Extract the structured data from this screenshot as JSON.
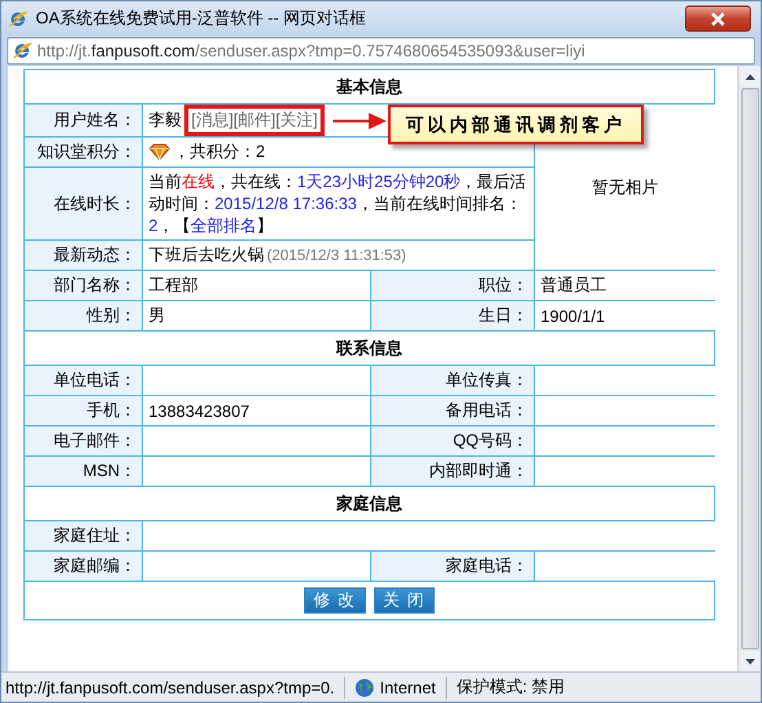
{
  "window": {
    "title": "OA系统在线免费试用-泛普软件 -- 网页对话框",
    "address": {
      "prefix": "http://jt.",
      "domain": "fanpusoft.com",
      "rest": "/senduser.aspx?tmp=0.7574680654535093&user=liyi"
    }
  },
  "sections": [
    {
      "title": "基本信息",
      "photo": "暂无相片",
      "rows": [
        {
          "kind": "name",
          "label": "用户姓名：",
          "value": "李毅",
          "links": [
            "[消息]",
            "[邮件]",
            "[关注]"
          ]
        },
        {
          "kind": "points",
          "label": "知识堂积分：",
          "value": "，共积分：2"
        },
        {
          "kind": "segments",
          "label": "在线时长：",
          "segments": [
            {
              "kind": "plain",
              "text": "当前"
            },
            {
              "kind": "red",
              "text": "在线"
            },
            {
              "kind": "plain",
              "text": "，共在线："
            },
            {
              "kind": "blue",
              "text": "1天23小时25分钟20秒"
            },
            {
              "kind": "plain",
              "text": "，最后活动时间："
            },
            {
              "kind": "blue",
              "text": "2015/12/8 17:36:33"
            },
            {
              "kind": "plain",
              "text": "，当前在线时间排名："
            },
            {
              "kind": "blue",
              "text": "2"
            },
            {
              "kind": "plain",
              "text": "，【"
            },
            {
              "kind": "link",
              "text": "全部排名"
            },
            {
              "kind": "plain",
              "text": "】"
            }
          ]
        },
        {
          "kind": "status",
          "label": "最新动态：",
          "value": "下班后去吃火锅",
          "time": "(2015/12/3 11:31:53)"
        },
        {
          "kind": "pair",
          "cells": [
            {
              "label": "部门名称：",
              "value": "工程部"
            },
            {
              "label": "职位：",
              "value": "普通员工"
            }
          ]
        },
        {
          "kind": "pair",
          "cells": [
            {
              "label": "性别：",
              "value": "男"
            },
            {
              "label": "生日：",
              "value": "1900/1/1"
            }
          ]
        }
      ]
    },
    {
      "title": "联系信息",
      "rows": [
        {
          "kind": "pair",
          "cells": [
            {
              "label": "单位电话："
            },
            {
              "label": "单位传真："
            }
          ]
        },
        {
          "kind": "pair",
          "cells": [
            {
              "label": "手机：",
              "value": "13883423807"
            },
            {
              "label": "备用电话："
            }
          ]
        },
        {
          "kind": "pair",
          "cells": [
            {
              "label": "电子邮件："
            },
            {
              "label": "QQ号码："
            }
          ]
        },
        {
          "kind": "pair",
          "cells": [
            {
              "label": "MSN："
            },
            {
              "label": "内部即时通："
            }
          ]
        }
      ]
    },
    {
      "title": "家庭信息",
      "rows": [
        {
          "kind": "full",
          "label": "家庭住址："
        },
        {
          "kind": "pair",
          "cells": [
            {
              "label": "家庭邮编："
            },
            {
              "label": "家庭电话："
            }
          ]
        }
      ]
    }
  ],
  "buttons": [
    "修 改",
    "关 闭"
  ],
  "annotation": {
    "text": "可以内部通讯调剂客户"
  },
  "status_bar": {
    "url": "http://jt.fanpusoft.com/senduser.aspx?tmp=0.",
    "zone": "Internet",
    "mode": "保护模式: 禁用"
  }
}
